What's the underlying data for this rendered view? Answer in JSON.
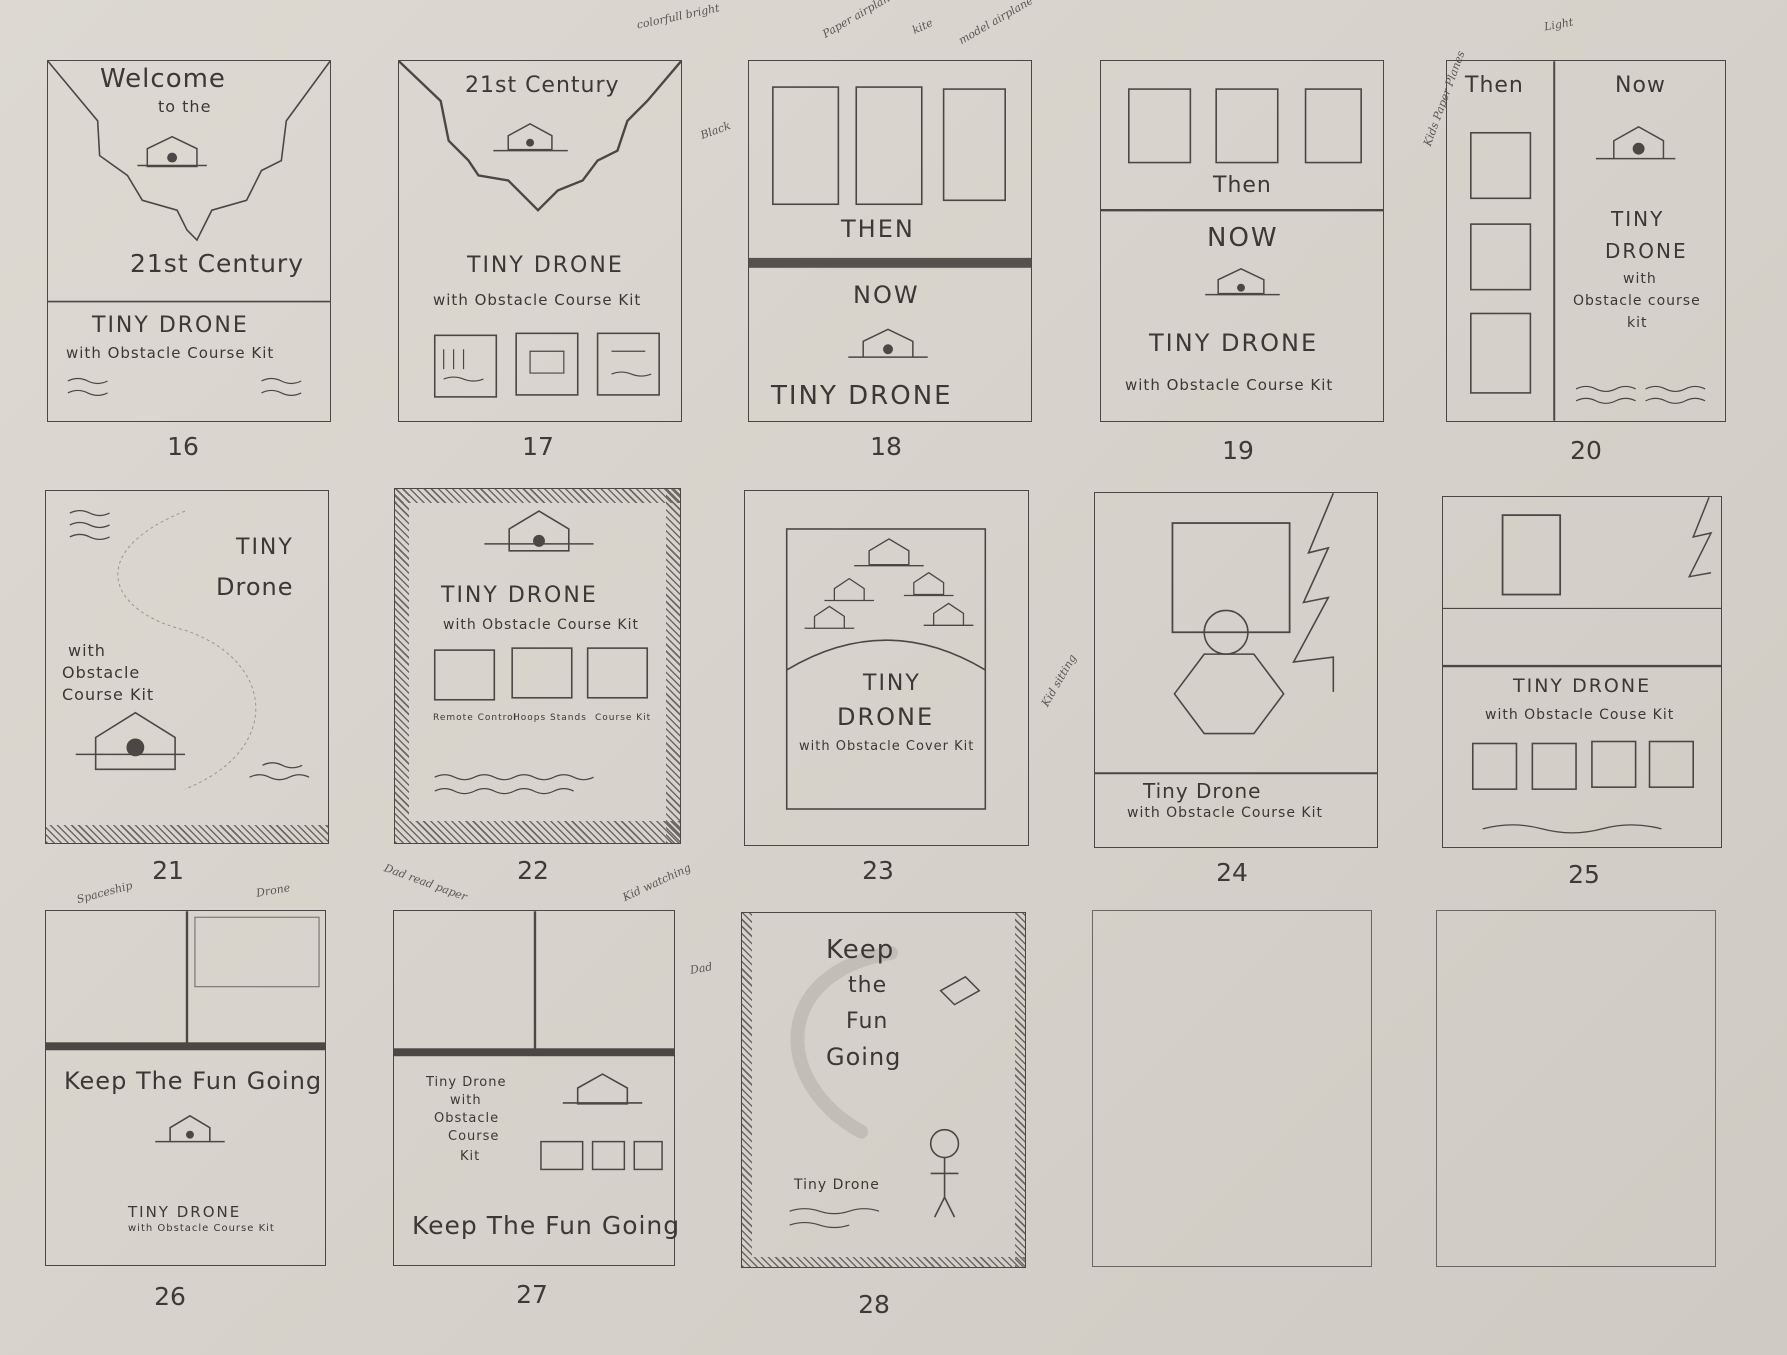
{
  "frames": [
    {
      "number": "16",
      "texts": {
        "welcome": "Welcome",
        "to_the": "to the",
        "century": "21st Century",
        "title": "TINY DRONE",
        "subtitle": "with Obstacle Course Kit"
      }
    },
    {
      "number": "17",
      "texts": {
        "century": "21st Century",
        "title": "TINY DRONE",
        "subtitle": "with Obstacle Course Kit"
      }
    },
    {
      "number": "18",
      "texts": {
        "then": "THEN",
        "now": "NOW",
        "title": "TINY DRONE"
      }
    },
    {
      "number": "19",
      "texts": {
        "then": "Then",
        "now": "NOW",
        "title": "TINY DRONE",
        "subtitle": "with Obstacle Course Kit"
      }
    },
    {
      "number": "20",
      "texts": {
        "then": "Then",
        "now": "Now",
        "title_line1": "TINY",
        "title_line2": "DRONE",
        "with": "with",
        "obstacle": "Obstacle course",
        "kit": "kit"
      }
    },
    {
      "number": "21",
      "texts": {
        "tiny": "TINY",
        "drone": "Drone",
        "with": "with",
        "obstacle": "Obstacle",
        "course": "Course Kit"
      }
    },
    {
      "number": "22",
      "texts": {
        "title": "TINY DRONE",
        "subtitle": "with Obstacle Course Kit",
        "label_remote": "Remote Control",
        "label_hoops": "Hoops Stands",
        "label_course": "Course Kit"
      }
    },
    {
      "number": "23",
      "texts": {
        "tiny": "TINY",
        "drone": "DRONE",
        "subtitle": "with Obstacle Cover Kit"
      }
    },
    {
      "number": "24",
      "texts": {
        "title": "Tiny Drone",
        "subtitle": "with Obstacle Course Kit"
      }
    },
    {
      "number": "25",
      "texts": {
        "title": "TINY DRONE",
        "subtitle": "with Obstacle Couse Kit"
      }
    },
    {
      "number": "26",
      "texts": {
        "headline": "Keep The Fun Going",
        "title": "TINY DRONE",
        "subtitle": "with Obstacle Course Kit"
      }
    },
    {
      "number": "27",
      "texts": {
        "body_line1": "Tiny Drone",
        "body_line2": "with",
        "body_line3": "Obstacle",
        "body_line4": "Course",
        "body_line5": "Kit",
        "headline": "Keep The Fun Going"
      }
    },
    {
      "number": "28",
      "texts": {
        "line1": "Keep",
        "line2": "the",
        "line3": "Fun",
        "line4": "Going",
        "brand": "Tiny Drone"
      }
    }
  ],
  "annotations": {
    "colorful_bright": "colorfull bright",
    "black": "Black",
    "paper_airplane": "Paper airplane",
    "kite": "kite",
    "model_airplane": "model airplane",
    "kids_paper_planes": "Kids Paper Planes",
    "light": "Light",
    "kid_sitting": "Kid sitting",
    "spaceship": "Spaceship",
    "drone": "Drone",
    "dad_reading_paper": "Dad read paper",
    "kid_watching": "Kid watching",
    "dad": "Dad"
  }
}
